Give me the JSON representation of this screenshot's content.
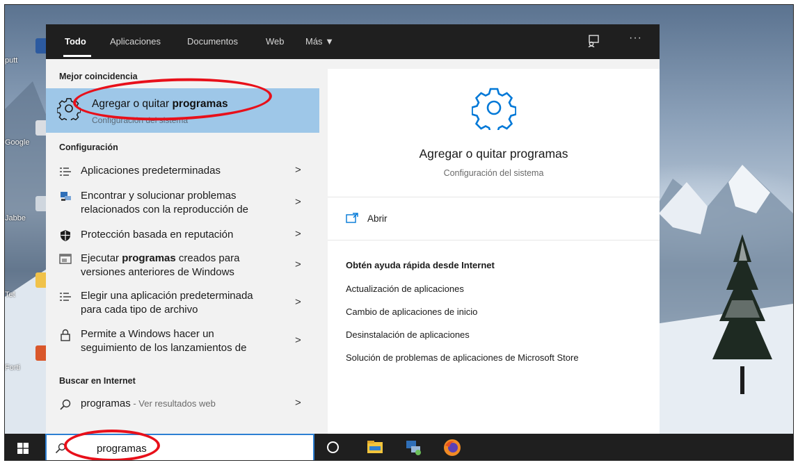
{
  "desktop": {
    "icons": [
      {
        "label": "putt",
        "icon": "putty-icon"
      },
      {
        "label": "Google",
        "icon": "chrome-shortcut-icon"
      },
      {
        "label": "Jabbe",
        "icon": "jabber-shortcut-icon"
      },
      {
        "label": "Tet",
        "icon": "folder-icon"
      },
      {
        "label": "Forti",
        "icon": "forticlient-icon"
      }
    ]
  },
  "tabs": [
    {
      "label": "Todo",
      "active": true
    },
    {
      "label": "Aplicaciones"
    },
    {
      "label": "Documentos"
    },
    {
      "label": "Web"
    },
    {
      "label": "Más ▼"
    }
  ],
  "header_icons": {
    "feedback": "feedback-icon",
    "more": "···"
  },
  "best_match": {
    "heading": "Mejor coincidencia",
    "title_plain": "Agregar o quitar ",
    "title_bold": "programas",
    "subtitle": "Configuración del sistema",
    "icon": "gear-icon"
  },
  "settings": {
    "heading": "Configuración",
    "items": [
      {
        "icon": "list-icon",
        "line1": "Aplicaciones predeterminadas",
        "line2": ""
      },
      {
        "icon": "troubleshoot-icon",
        "line1": "Encontrar y solucionar problemas",
        "line2": "relacionados con la reproducción de"
      },
      {
        "icon": "shield-icon",
        "line1": "Protección basada en reputación",
        "line2": ""
      },
      {
        "icon": "compat-icon",
        "line1_plain": "Ejecutar ",
        "line1_bold": "programas",
        "line1_rest": " creados para",
        "line2": "versiones anteriores de Windows"
      },
      {
        "icon": "list-icon",
        "line1": "Elegir una aplicación predeterminada",
        "line2": "para cada tipo de archivo"
      },
      {
        "icon": "lock-icon",
        "line1": "Permite a Windows hacer un",
        "line2": "seguimiento de los lanzamientos de"
      }
    ],
    "chevron": ">"
  },
  "web": {
    "heading": "Buscar en Internet",
    "query": "programas",
    "suffix": " - Ver resultados web",
    "icon": "search-icon"
  },
  "detail": {
    "title": "Agregar o quitar programas",
    "subtitle": "Configuración del sistema",
    "open_label": "Abrir",
    "help_heading": "Obtén ayuda rápida desde Internet",
    "help_links": [
      "Actualización de aplicaciones",
      "Cambio de aplicaciones de inicio",
      "Desinstalación de aplicaciones",
      "Solución de problemas de aplicaciones de Microsoft Store"
    ]
  },
  "taskbar": {
    "search_value": "programas",
    "apps": [
      "cortana-icon",
      "file-explorer-icon",
      "network-app-icon",
      "firefox-icon"
    ]
  },
  "colors": {
    "accent": "#0078d7",
    "selection": "#9ec7e8",
    "annotation": "#e8101a",
    "dark": "#1f1f1f"
  }
}
